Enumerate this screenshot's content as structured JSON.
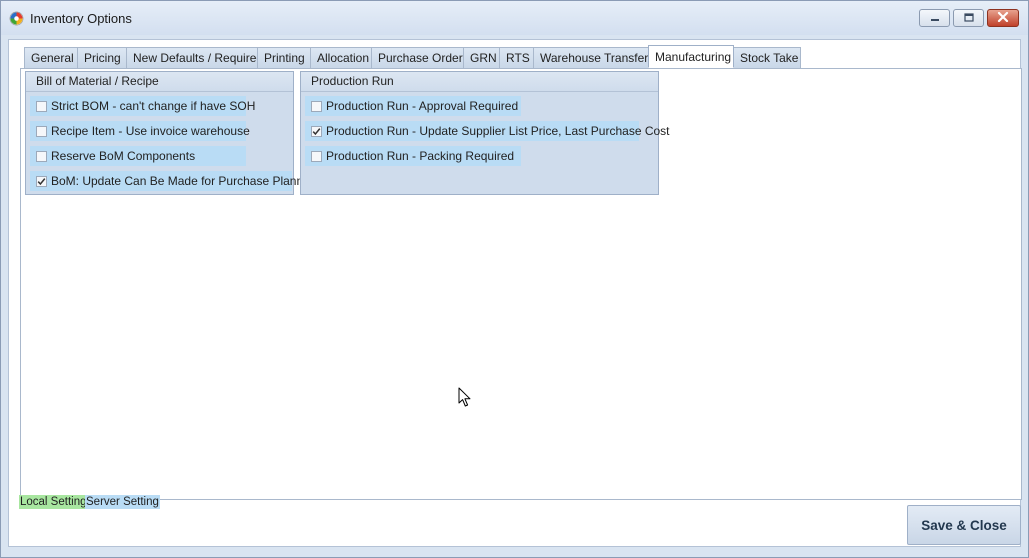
{
  "window": {
    "title": "Inventory Options"
  },
  "tabs": [
    {
      "label": "General",
      "active": false
    },
    {
      "label": "Pricing",
      "active": false
    },
    {
      "label": "New Defaults / Required",
      "active": false
    },
    {
      "label": "Printing",
      "active": false
    },
    {
      "label": "Allocation",
      "active": false
    },
    {
      "label": "Purchase Order",
      "active": false
    },
    {
      "label": "GRN",
      "active": false
    },
    {
      "label": "RTS",
      "active": false
    },
    {
      "label": "Warehouse Transfer",
      "active": false
    },
    {
      "label": "Manufacturing",
      "active": true
    },
    {
      "label": "Stock Take",
      "active": false
    }
  ],
  "bom_group": {
    "title": "Bill of Material / Recipe",
    "options": [
      {
        "label": "Strict BOM - can't change if have SOH",
        "checked": false
      },
      {
        "label": "Recipe Item - Use invoice warehouse",
        "checked": false
      },
      {
        "label": "Reserve BoM Components",
        "checked": false
      },
      {
        "label": "BoM: Update Can Be Made for Purchase Planning",
        "checked": true
      }
    ]
  },
  "production_group": {
    "title": "Production Run",
    "options": [
      {
        "label": "Production Run - Approval Required",
        "checked": false
      },
      {
        "label": "Production Run - Update Supplier List Price, Last Purchase Cost",
        "checked": true
      },
      {
        "label": "Production Run - Packing Required",
        "checked": false
      }
    ]
  },
  "legend": {
    "local": "Local Setting",
    "server": "Server Setting",
    "local_color": "#a8e6a0",
    "server_color": "#b9dcf5"
  },
  "buttons": {
    "save_close": "Save & Close"
  },
  "icons": {
    "app": "app-logo-icon",
    "minimize": "minimize-icon",
    "maximize": "maximize-icon",
    "close": "close-icon",
    "cursor": "mouse-cursor-icon",
    "check": "checkmark-icon"
  }
}
